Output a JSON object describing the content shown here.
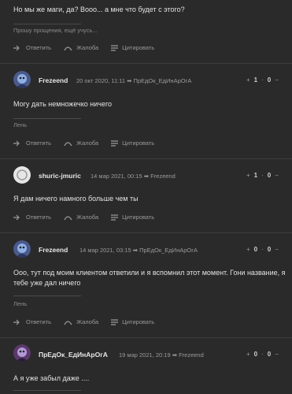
{
  "posts": [
    {
      "text": "Но мы же маги, да? Вооо... а мне что будет с этого?",
      "signature": "Прошу прощения, ещё учусь...",
      "actions": {
        "reply": "Ответить",
        "complain": "Жалоба",
        "quote": "Цитировать"
      }
    },
    {
      "author": "Frezeend",
      "meta": "20 окт 2020, 11:11 ➡ ПрЕдОк_ЕдИнАрОгА",
      "vote": {
        "plus": "+",
        "up": "1",
        "sep": "·",
        "down": "0",
        "minus": "−"
      },
      "text": "Могу дать немножечко ничего",
      "signature": "Лень",
      "actions": {
        "reply": "Ответить",
        "complain": "Жалоба",
        "quote": "Цитировать"
      }
    },
    {
      "author": "shuric-jmuric",
      "meta": "14 мар 2021, 00:15 ➡ Frezeend",
      "vote": {
        "plus": "+",
        "up": "1",
        "sep": "·",
        "down": "0",
        "minus": "−"
      },
      "text": "Я дам ничего намного больше чем ты",
      "actions": {
        "reply": "Ответить",
        "complain": "Жалоба",
        "quote": "Цитировать"
      }
    },
    {
      "author": "Frezeend",
      "meta": "14 мар 2021, 03:15 ➡ ПрЕдОк_ЕдИнАрОгА",
      "vote": {
        "plus": "+",
        "up": "0",
        "sep": "·",
        "down": "0",
        "minus": "−"
      },
      "text_line1": "Ооо, тут под моим клиентом ответили и я вспомнил этот момент. Гони название, я",
      "text_line2": "тебе уже дал ничего",
      "signature": "Лень",
      "actions": {
        "reply": "Ответить",
        "complain": "Жалоба",
        "quote": "Цитировать"
      }
    },
    {
      "author": "ПрЕдОк_ЕдИнАрОгА",
      "meta": "19 мар 2021, 20:19 ➡ Frezeend",
      "vote": {
        "plus": "+",
        "up": "0",
        "sep": "·",
        "down": "0",
        "minus": "−"
      },
      "text": "А я уже забыл даже ...."
    }
  ],
  "colors": {
    "background": "#2a2a2b",
    "positive": "#5fbf4f",
    "muted": "#9a9a9a"
  }
}
